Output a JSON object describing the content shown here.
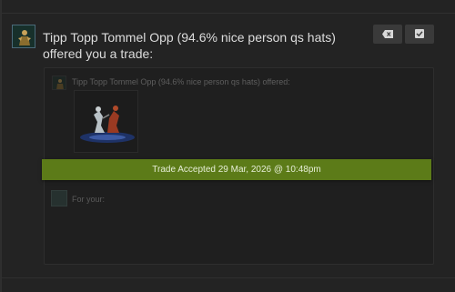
{
  "notification": {
    "headline": "Tipp Topp Tommel Opp (94.6% nice person qs hats) offered you a trade:",
    "buttons": {
      "dismiss_icon": "dismiss-tag-icon",
      "accept_icon": "checkbox-icon"
    }
  },
  "trade": {
    "offered_label": "Tipp Topp Tommel Opp (94.6% nice person qs hats) offered:",
    "item_icon": "taunt-item-icon",
    "for_your_label": "For your:",
    "status": "Trade Accepted 29 Mar, 2026 @ 10:48pm"
  },
  "colors": {
    "status_banner": "#5c7b18",
    "background": "#1b1b1b"
  }
}
